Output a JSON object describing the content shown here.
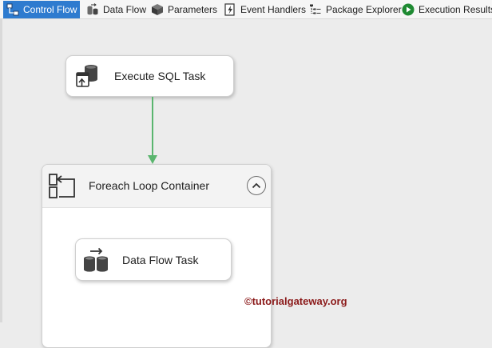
{
  "tabs": [
    {
      "label": "Control Flow",
      "icon": "control-flow-icon",
      "active": true
    },
    {
      "label": "Data Flow",
      "icon": "data-flow-icon",
      "active": false
    },
    {
      "label": "Parameters",
      "icon": "parameters-icon",
      "active": false
    },
    {
      "label": "Event Handlers",
      "icon": "event-handlers-icon",
      "active": false
    },
    {
      "label": "Package Explorer",
      "icon": "package-explorer-icon",
      "active": false
    },
    {
      "label": "Execution Results",
      "icon": "execution-results-icon",
      "active": false
    }
  ],
  "canvas": {
    "execute_sql_task": {
      "label": "Execute SQL Task",
      "icon": "execute-sql-icon"
    },
    "precedence_constraint": {
      "color": "#5ab56e"
    },
    "foreach_loop_container": {
      "title": "Foreach Loop Container",
      "icon": "foreach-loop-icon",
      "collapse_icon": "chevron-up-icon",
      "data_flow_task": {
        "label": "Data Flow Task",
        "icon": "data-flow-task-icon"
      }
    }
  },
  "watermark": "©tutorialgateway.org",
  "colors": {
    "accent": "#2e7bcf",
    "constraint": "#5ab56e",
    "watermark": "#8b1a1a"
  }
}
